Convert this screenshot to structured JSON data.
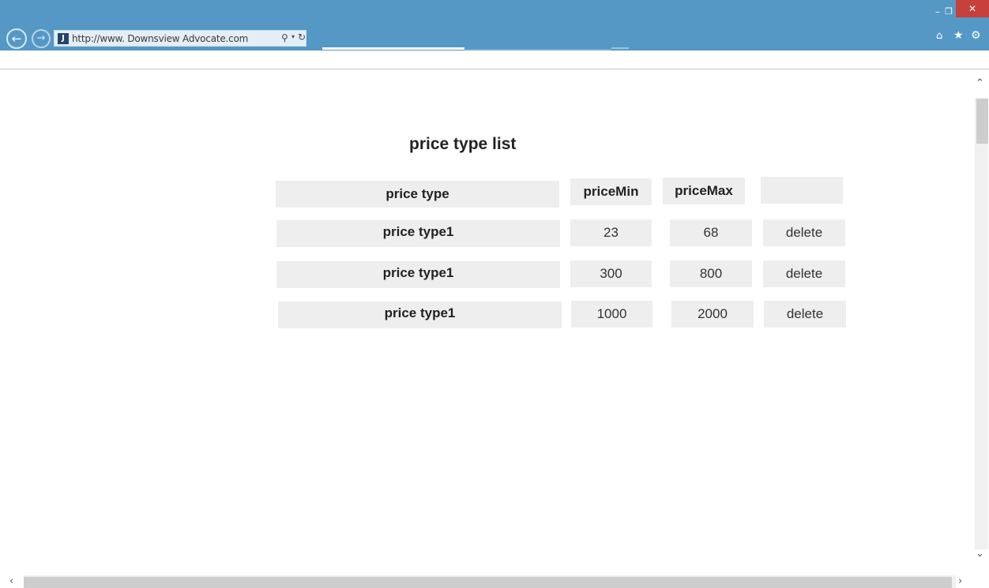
{
  "browser": {
    "url": "http://www. Downsview Advocate.com",
    "favicon_glyph": "J",
    "back_glyph": "←",
    "forward_glyph": "→",
    "search_glyph": "⚲",
    "dropdown_glyph": "▾",
    "refresh_glyph": "↻",
    "minimize_glyph": "–",
    "restore_glyph": "❐",
    "close_glyph": "✕",
    "home_glyph": "⌂",
    "favorites_glyph": "★",
    "tools_glyph": "⚙",
    "accent_color": "#5598c6",
    "close_color": "#c7403b"
  },
  "page": {
    "title": "price type list",
    "table": {
      "headers": {
        "type": "price type",
        "min": "priceMin",
        "max": "priceMax",
        "action": ""
      },
      "rows": [
        {
          "type": "price type1",
          "min": "23",
          "max": "68",
          "action": "delete"
        },
        {
          "type": "price type1",
          "min": "300",
          "max": "800",
          "action": "delete"
        },
        {
          "type": "price type1",
          "min": "1000",
          "max": "2000",
          "action": "delete"
        }
      ]
    }
  },
  "scrollbars": {
    "up_glyph": "⌃",
    "down_glyph": "⌄",
    "left_glyph": "‹",
    "right_glyph": "›"
  }
}
